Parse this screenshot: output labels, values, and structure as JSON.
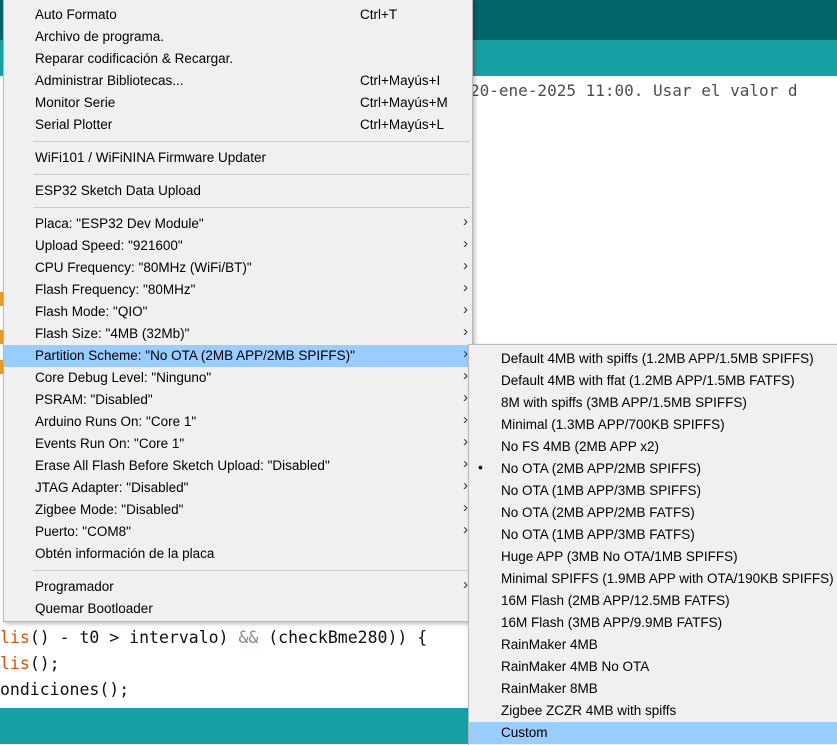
{
  "background": {
    "console_text": "20-ene-2025 11:00. Usar el valor d",
    "code": {
      "line1_fn": "lis",
      "line1_rest": "() - t0 > intervalo) ",
      "line1_op": "&&",
      "line1_end": " (checkBme280)) {",
      "line2_fn": "lis",
      "line2_rest": "();",
      "line3": "ondiciones();"
    }
  },
  "menu": {
    "items": [
      {
        "label": "Auto Formato",
        "shortcut": "Ctrl+T"
      },
      {
        "label": "Archivo de programa.",
        "shortcut": ""
      },
      {
        "label": "Reparar codificación & Recargar.",
        "shortcut": ""
      },
      {
        "label": "Administrar Bibliotecas...",
        "shortcut": "Ctrl+Mayús+I"
      },
      {
        "label": "Monitor Serie",
        "shortcut": "Ctrl+Mayús+M"
      },
      {
        "label": "Serial Plotter",
        "shortcut": "Ctrl+Mayús+L"
      },
      {
        "label": "WiFi101 / WiFiNINA Firmware Updater"
      },
      {
        "label": "ESP32 Sketch Data Upload"
      },
      {
        "label": "Placa: \"ESP32 Dev Module\""
      },
      {
        "label": "Upload Speed: \"921600\""
      },
      {
        "label": "CPU Frequency: \"80MHz (WiFi/BT)\""
      },
      {
        "label": "Flash Frequency: \"80MHz\""
      },
      {
        "label": "Flash Mode: \"QIO\""
      },
      {
        "label": "Flash Size: \"4MB (32Mb)\""
      },
      {
        "label": "Partition Scheme: \"No OTA (2MB APP/2MB SPIFFS)\""
      },
      {
        "label": "Core Debug Level: \"Ninguno\""
      },
      {
        "label": "PSRAM: \"Disabled\""
      },
      {
        "label": "Arduino Runs On: \"Core 1\""
      },
      {
        "label": "Events Run On: \"Core 1\""
      },
      {
        "label": "Erase All Flash Before Sketch Upload: \"Disabled\""
      },
      {
        "label": "JTAG Adapter: \"Disabled\""
      },
      {
        "label": "Zigbee Mode: \"Disabled\""
      },
      {
        "label": "Puerto: \"COM8\""
      },
      {
        "label": "Obtén información de la placa"
      },
      {
        "label": "Programador"
      },
      {
        "label": "Quemar Bootloader"
      }
    ],
    "arrow": "›"
  },
  "submenu": {
    "bullet": "•",
    "items": [
      "Default 4MB with spiffs (1.2MB APP/1.5MB SPIFFS)",
      "Default 4MB with ffat (1.2MB APP/1.5MB FATFS)",
      "8M with spiffs (3MB APP/1.5MB SPIFFS)",
      "Minimal (1.3MB APP/700KB SPIFFS)",
      "No FS 4MB (2MB APP x2)",
      "No OTA (2MB APP/2MB SPIFFS)",
      "No OTA (1MB APP/3MB SPIFFS)",
      "No OTA (2MB APP/2MB FATFS)",
      "No OTA (1MB APP/3MB FATFS)",
      "Huge APP (3MB No OTA/1MB SPIFFS)",
      "Minimal SPIFFS (1.9MB APP with OTA/190KB SPIFFS)",
      "16M Flash (2MB APP/12.5MB FATFS)",
      "16M Flash (3MB APP/9.9MB FATFS)",
      "RainMaker 4MB",
      "RainMaker 4MB No OTA",
      "RainMaker 8MB",
      "Zigbee ZCZR 4MB with spiffs",
      "Custom"
    ]
  }
}
